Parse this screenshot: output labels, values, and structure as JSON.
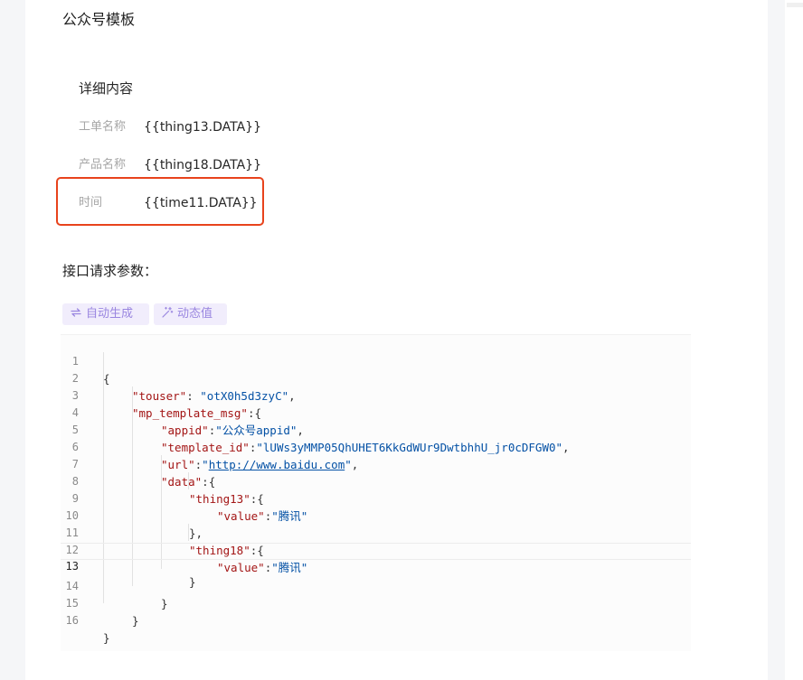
{
  "section": {
    "title": "公众号模板"
  },
  "detail": {
    "title": "详细内容",
    "fields": [
      {
        "label": "工单名称",
        "value": "{{thing13.DATA}}"
      },
      {
        "label": "产品名称",
        "value": "{{thing18.DATA}}"
      },
      {
        "label": "时间",
        "value": "{{time11.DATA}}"
      }
    ]
  },
  "params": {
    "title": "接口请求参数：",
    "buttons": [
      {
        "label": "自动生成",
        "icon": "refresh-icon"
      },
      {
        "label": "动态值",
        "icon": "magic-wand-icon"
      }
    ]
  },
  "code": {
    "active_line": 13,
    "lines": [
      {
        "n": "1",
        "text": "{"
      },
      {
        "n": "2",
        "key": "\"touser\"",
        "sep": ": ",
        "val": "\"otX0h5d3zyC\"",
        "end": ","
      },
      {
        "n": "3",
        "key": "\"mp_template_msg\"",
        "sep": ":",
        "end": "{"
      },
      {
        "n": "4",
        "key": "\"appid\"",
        "sep": ":",
        "val": "\"公众号appid\"",
        "end": ","
      },
      {
        "n": "5",
        "key": "\"template_id\"",
        "sep": ":",
        "val": "\"lUWs3yMMP05QhUHET6KkGdWUr9DwtbhhU_jr0cDFGW0\"",
        "end": ","
      },
      {
        "n": "6",
        "key": "\"url\"",
        "sep": ":",
        "q1": "\"",
        "link": "http://www.baidu.com",
        "q2": "\"",
        "end": ","
      },
      {
        "n": "7",
        "key": "\"data\"",
        "sep": ":",
        "end": "{"
      },
      {
        "n": "8",
        "key": "\"thing13\"",
        "sep": ":",
        "end": "{"
      },
      {
        "n": "9",
        "key": "\"value\"",
        "sep": ":",
        "val": "\"腾讯\""
      },
      {
        "n": "10",
        "text": "},"
      },
      {
        "n": "11",
        "key": "\"thing18\"",
        "sep": ":",
        "end": "{"
      },
      {
        "n": "12",
        "key": "\"value\"",
        "sep": ":",
        "val": "\"腾讯\""
      },
      {
        "n": "13",
        "text": "}"
      },
      {
        "n": "14",
        "text": "}"
      },
      {
        "n": "15",
        "text": "}"
      },
      {
        "n": "16",
        "text": "}"
      }
    ]
  },
  "colors": {
    "highlight_border": "#e8431c",
    "button_bg": "#f1edfc",
    "button_text": "#9a86e0"
  }
}
